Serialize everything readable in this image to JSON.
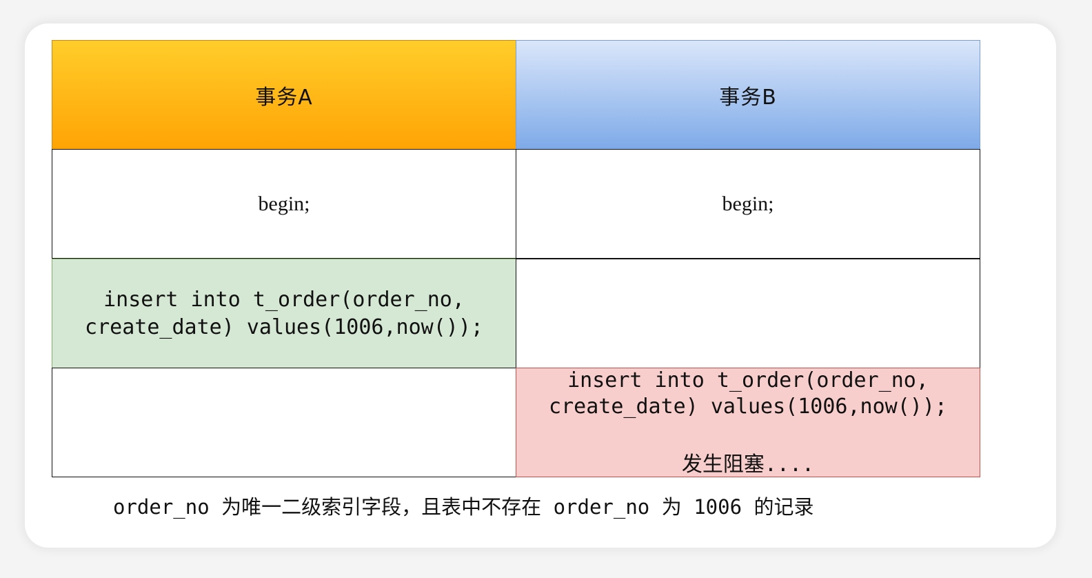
{
  "table": {
    "header_a": "事务A",
    "header_b": "事务B",
    "row1_a": "begin;",
    "row1_b": "begin;",
    "row2_a_line1": "insert into t_order(order_no,",
    "row2_a_line2": "create_date) values(1006,now());",
    "row2_b": "",
    "row3_a": "",
    "row3_b_line1": "insert into t_order(order_no,",
    "row3_b_line2": "create_date) values(1006,now());",
    "row3_b_status": "发生阻塞...."
  },
  "caption": "order_no 为唯一二级索引字段，且表中不存在 order_no 为 1006 的记录",
  "colors": {
    "header_a_top": "#ffcd2a",
    "header_a_bottom": "#ffa405",
    "header_b_top": "#dae6fa",
    "header_b_bottom": "#7eaae8",
    "green_fill": "#d5e8d4",
    "red_fill": "#f8cecc"
  }
}
